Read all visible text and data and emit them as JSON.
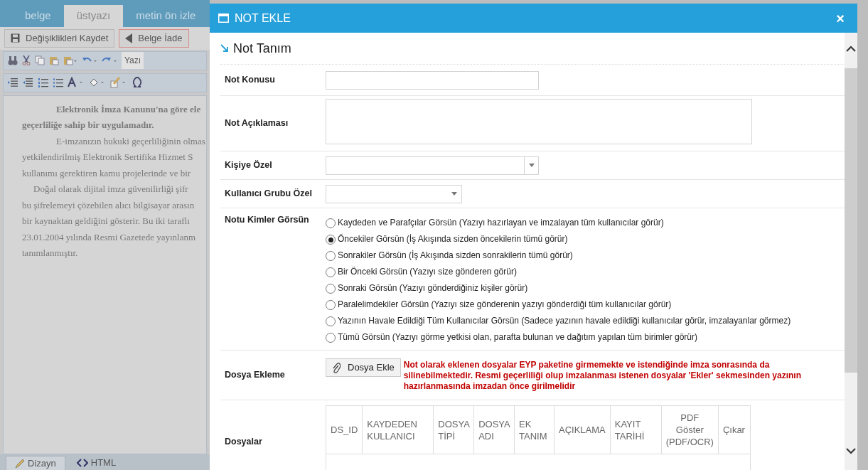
{
  "document_tabs": [
    {
      "label": "belge",
      "selected": false
    },
    {
      "label": "üstyazı",
      "selected": true
    },
    {
      "label": "metin ön izle",
      "selected": false
    }
  ],
  "action_buttons": [
    {
      "label": "Değişiklikleri Kaydet",
      "kind": "save"
    },
    {
      "label": "Belge İade",
      "kind": "return"
    }
  ],
  "font_select": {
    "value": "Yazı"
  },
  "editor_lines": [
    {
      "text": "Elektronik İmza Kanunu'na göre ele",
      "kind": "bold-indent"
    },
    {
      "text": "geçerliliğe sahip bir uygulamadır.",
      "kind": "bold"
    },
    {
      "text": "E-imzanızın hukuki geçerliliğinin olmas",
      "kind": "indent"
    },
    {
      "text": "yetkilendirilmiş Elektronik Sertifika Hizmet S",
      "kind": "plain"
    },
    {
      "text": "kullanımı gerektiren kamu projelerinde ve bir",
      "kind": "plain"
    },
    {
      "text": "Doğal olarak dijital imza güvenilirliği şifr",
      "kind": "indent-small"
    },
    {
      "text": "bu şifrelemeyi çözebilen alıcı bilgisayar arasın",
      "kind": "plain"
    },
    {
      "text": "bir kaynaktan geldiğini gösterir. Bu iki taraflı",
      "kind": "plain"
    },
    {
      "text": "23.01.2004 yılında Resmi Gazetede yayınlanm",
      "kind": "plain"
    },
    {
      "text": "tanımlanmıştır.",
      "kind": "plain"
    }
  ],
  "view_tabs": [
    {
      "label": "Dizayn",
      "selected": true
    },
    {
      "label": "HTML",
      "selected": false
    }
  ],
  "dialog": {
    "title": "NOT EKLE",
    "close": "×",
    "section": "Not Tanım",
    "fields": [
      {
        "label": "Not Konusu",
        "kind": "text"
      },
      {
        "label": "Not Açıklaması",
        "kind": "textarea"
      },
      {
        "label": "Kişiye Özel",
        "kind": "select"
      },
      {
        "label": "Kullanıcı Grubu Özel",
        "kind": "select-small"
      },
      {
        "label": "Notu Kimler Görsün",
        "kind": "radios",
        "options": [
          {
            "label": "Kaydeden ve Parafçılar Görsün (Yazıyı hazırlayan ve imzalayan tüm kullanıcılar görür)",
            "selected": false
          },
          {
            "label": "Öncekiler Görsün (İş Akışında sizden öncekilerin tümü görür)",
            "selected": true
          },
          {
            "label": "Sonrakiler Görsün (İş Akışında sizden sonrakilerin tümü görür)",
            "selected": false
          },
          {
            "label": "Bir Önceki Görsün (Yazıyı size gönderen görür)",
            "selected": false
          },
          {
            "label": "Sonraki Görsün (Yazıyı gönderdiğiniz kişiler görür)",
            "selected": false
          },
          {
            "label": "Paralelimdekiler Görsün (Yazıyı size gönderenin yazıyı gönderdiği tüm kullanıcılar görür)",
            "selected": false
          },
          {
            "label": "Yazının Havale Edildiği Tüm Kullanıcılar Görsün (Sadece yazının havale edildiği kullanıcılar görür, imzalayanlar görmez)",
            "selected": false
          },
          {
            "label": "Tümü Görsün (Yazıyı görme yetkisi olan, parafta bulunan ve dağıtım yapılan tüm birimler görür)",
            "selected": false
          }
        ]
      },
      {
        "label": "Dosya Ekleme",
        "kind": "file",
        "button": "Dosya Ekle",
        "warning": "Not olarak eklenen dosyalar EYP paketine girmemekte ve istendiğinde imza sonrasında da silinebilmektedir. Resmi geçerliliği olup imzalanması istenen dosyalar 'Ekler' sekmesinden yazının hazırlanmasında imzadan önce girilmelidir"
      },
      {
        "label": "Dosyalar",
        "kind": "table",
        "columns": [
          "DS_ID",
          "KAYDEDEN KULLANICI",
          "DOSYA TİPİ",
          "DOSYA ADI",
          "EK TANIM",
          "AÇIKLAMA",
          "KAYIT TARİHİ",
          "PDF Göster (PDF/OCR)",
          "Çıkar"
        ]
      }
    ]
  }
}
